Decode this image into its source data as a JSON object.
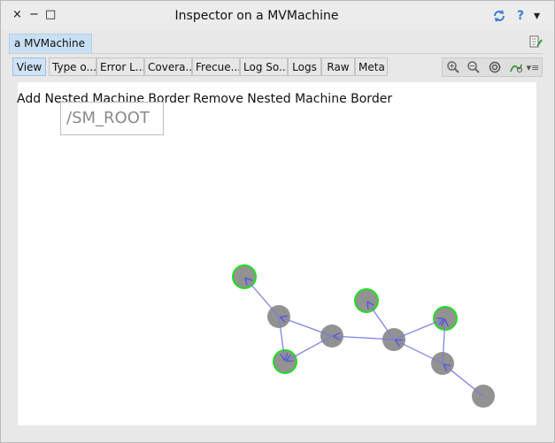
{
  "window": {
    "title": "Inspector on a MVMachine",
    "close_glyph": "×",
    "minimize_glyph": "−",
    "maximize_glyph": "□",
    "refresh_icon": "refresh-icon",
    "help_glyph": "?",
    "menu_glyph": "▾"
  },
  "object_tab": {
    "label": "a MVMachine"
  },
  "tabs": [
    {
      "label": "View",
      "active": true
    },
    {
      "label": "Type o..."
    },
    {
      "label": "Error L..."
    },
    {
      "label": "Covera..."
    },
    {
      "label": "Frecue..."
    },
    {
      "label": "Log So..."
    },
    {
      "label": "Logs"
    },
    {
      "label": "Raw"
    },
    {
      "label": "Meta"
    }
  ],
  "toolbar": {
    "icons": [
      "zoom-in-icon",
      "zoom-out-icon",
      "zoom-reset-icon",
      "playground-icon",
      "menu-icon"
    ]
  },
  "canvas": {
    "add_border_label": "Add Nested Machine Border",
    "remove_border_label": "Remove Nested Machine Border",
    "root_label": "/SM_ROOT"
  },
  "graph": {
    "node_color": "#8c8c8c",
    "highlight_color": "#22dd22",
    "edge_color": "#7b7bdc",
    "nodes": [
      {
        "id": "n1",
        "highlighted": true
      },
      {
        "id": "n2",
        "highlighted": false
      },
      {
        "id": "n3",
        "highlighted": true
      },
      {
        "id": "n4",
        "highlighted": false
      },
      {
        "id": "n5",
        "highlighted": true
      },
      {
        "id": "n6",
        "highlighted": false
      },
      {
        "id": "n7",
        "highlighted": true
      },
      {
        "id": "n8",
        "highlighted": false
      },
      {
        "id": "n9",
        "highlighted": false
      }
    ],
    "edges": [
      [
        "n2",
        "n1"
      ],
      [
        "n2",
        "n3"
      ],
      [
        "n4",
        "n3"
      ],
      [
        "n4",
        "n2"
      ],
      [
        "n6",
        "n4"
      ],
      [
        "n6",
        "n5"
      ],
      [
        "n8",
        "n6"
      ],
      [
        "n8",
        "n7"
      ],
      [
        "n6",
        "n7"
      ],
      [
        "n9",
        "n8"
      ]
    ]
  }
}
